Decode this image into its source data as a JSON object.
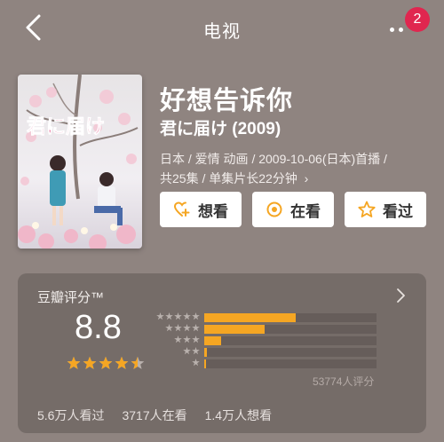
{
  "header": {
    "title": "电视",
    "notification_count": "2"
  },
  "show": {
    "title": "好想告诉你",
    "subtitle": "君に届け (2009)",
    "meta_line1": "日本 / 爱情 动画 / 2009-10-06(日本)首播 /",
    "meta_line2": "共25集 / 单集片长22分钟",
    "poster_text": "君に届け"
  },
  "actions": {
    "want_label": "想看",
    "watching_label": "在看",
    "watched_label": "看过"
  },
  "rating": {
    "title": "豆瓣评分™",
    "score": "8.8",
    "stars": 4.5,
    "distribution": [
      {
        "stars": 5,
        "fraction": 0.53
      },
      {
        "stars": 4,
        "fraction": 0.35
      },
      {
        "stars": 3,
        "fraction": 0.1
      },
      {
        "stars": 2,
        "fraction": 0.015
      },
      {
        "stars": 1,
        "fraction": 0.01
      }
    ],
    "count_text": "53774人评分",
    "watched": "5.6万人看过",
    "watching": "3717人在看",
    "want": "1.4万人想看"
  },
  "colors": {
    "accent": "#f5a623",
    "badge": "#e0264f",
    "background": "#8f8480"
  }
}
